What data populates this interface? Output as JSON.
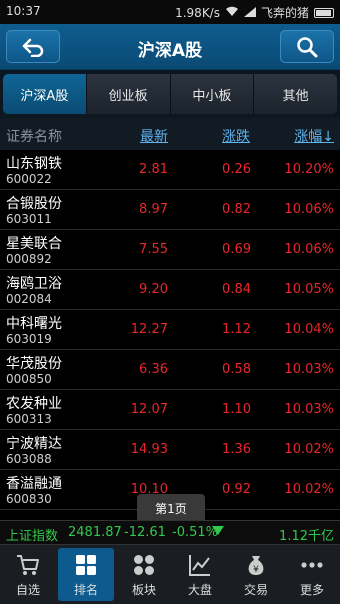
{
  "status": {
    "time": "10:37",
    "speed": "1.98K/s",
    "carrier": "飞奔的猪"
  },
  "header": {
    "title": "沪深A股"
  },
  "tabs": [
    {
      "label": "沪深A股",
      "active": true
    },
    {
      "label": "创业板",
      "active": false
    },
    {
      "label": "中小板",
      "active": false
    },
    {
      "label": "其他",
      "active": false
    }
  ],
  "columns": {
    "name": "证券名称",
    "latest": "最新",
    "change": "涨跌",
    "pct": "涨幅↓"
  },
  "rows": [
    {
      "name": "山东钢铁",
      "code": "600022",
      "latest": "2.81",
      "change": "0.26",
      "pct": "10.20%"
    },
    {
      "name": "合锻股份",
      "code": "603011",
      "latest": "8.97",
      "change": "0.82",
      "pct": "10.06%"
    },
    {
      "name": "星美联合",
      "code": "000892",
      "latest": "7.55",
      "change": "0.69",
      "pct": "10.06%"
    },
    {
      "name": "海鸥卫浴",
      "code": "002084",
      "latest": "9.20",
      "change": "0.84",
      "pct": "10.05%"
    },
    {
      "name": "中科曙光",
      "code": "603019",
      "latest": "12.27",
      "change": "1.12",
      "pct": "10.04%"
    },
    {
      "name": "华茂股份",
      "code": "000850",
      "latest": "6.36",
      "change": "0.58",
      "pct": "10.03%"
    },
    {
      "name": "农发种业",
      "code": "600313",
      "latest": "12.07",
      "change": "1.10",
      "pct": "10.03%"
    },
    {
      "name": "宁波精达",
      "code": "603088",
      "latest": "14.93",
      "change": "1.36",
      "pct": "10.02%"
    },
    {
      "name": "香溢融通",
      "code": "600830",
      "latest": "10.10",
      "change": "0.92",
      "pct": "10.02%"
    }
  ],
  "page_tip": "第1页",
  "index": {
    "name": "上证指数",
    "value": "2481.87",
    "change": "-12.61",
    "pct": "-0.51%",
    "volume": "1.12千亿"
  },
  "nav": [
    {
      "label": "自选",
      "icon": "cart-icon",
      "active": false
    },
    {
      "label": "排名",
      "icon": "grid-icon",
      "active": true
    },
    {
      "label": "板块",
      "icon": "blocks-icon",
      "active": false
    },
    {
      "label": "大盘",
      "icon": "chart-icon",
      "active": false
    },
    {
      "label": "交易",
      "icon": "money-bag-icon",
      "active": false
    },
    {
      "label": "更多",
      "icon": "more-icon",
      "active": false
    }
  ],
  "colors": {
    "up": "#e8262b",
    "down": "#32c84c",
    "link": "#5fb3ee",
    "accent": "#0c5a8e"
  }
}
